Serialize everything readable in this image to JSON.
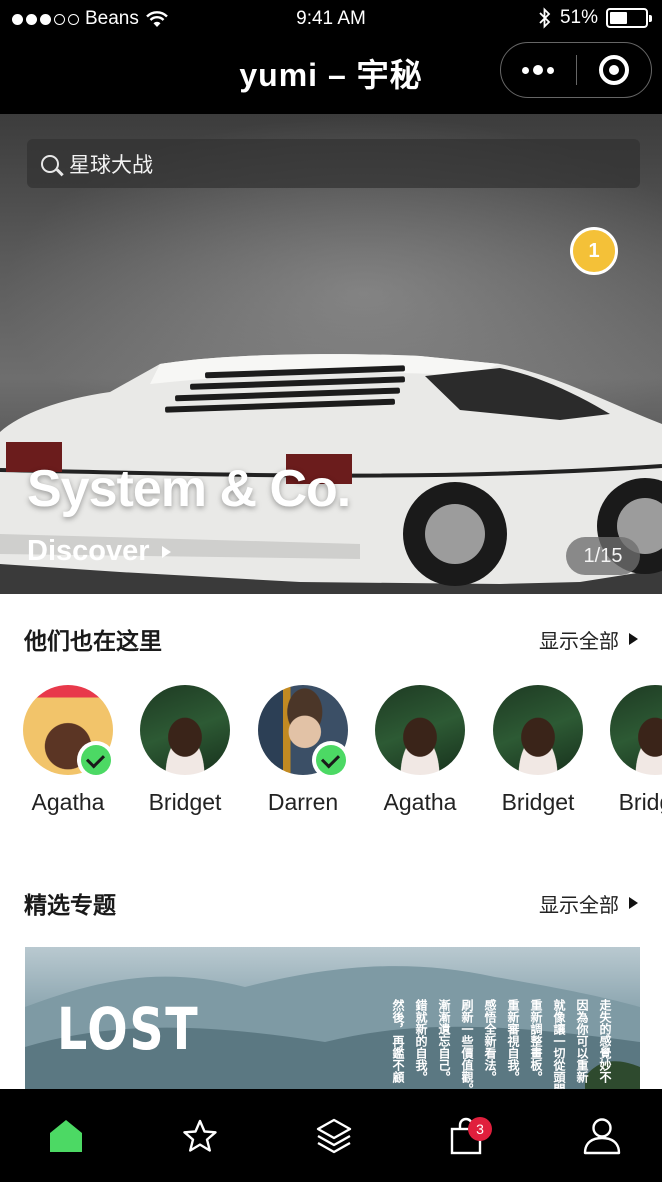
{
  "status_bar": {
    "carrier": "Beans",
    "time": "9:41 AM",
    "battery": "51%",
    "battery_level": 0.51,
    "signal_bars_filled": 3,
    "signal_bars_total": 5
  },
  "nav": {
    "title": "yumi – 宇秘"
  },
  "hero": {
    "search_query": "星球大战",
    "notification_count": "1",
    "title": "System & Co.",
    "cta": "Discover",
    "pager": "1/15",
    "badge_color": "#f4c138"
  },
  "people_section": {
    "title": "他们也在这里",
    "show_all": "显示全部",
    "people": [
      {
        "name": "Agatha",
        "verified": true
      },
      {
        "name": "Bridget",
        "verified": false
      },
      {
        "name": "Darren",
        "verified": true
      },
      {
        "name": "Agatha",
        "verified": false
      },
      {
        "name": "Bridget",
        "verified": false
      },
      {
        "name": "Bridget",
        "verified": false
      }
    ]
  },
  "featured_section": {
    "title": "精选专题",
    "show_all": "显示全部",
    "card": {
      "title": "LOST",
      "columns": [
        "走失的感覺妙不",
        "因為你可以重新",
        "就像讓一切從頭開",
        "重新調整畫板。",
        "重新審視自我。",
        "感悟全新看法。",
        "刷新一些價值觀。",
        "漸漸遺忘自己。",
        "錯就新的自我。",
        "然後，再鑑不顧"
      ]
    }
  },
  "tab_bar": {
    "cart_badge": "3",
    "active_color": "#4cd964",
    "tabs": [
      "home-icon",
      "star-icon",
      "layers-icon",
      "bag-icon",
      "profile-icon"
    ]
  }
}
